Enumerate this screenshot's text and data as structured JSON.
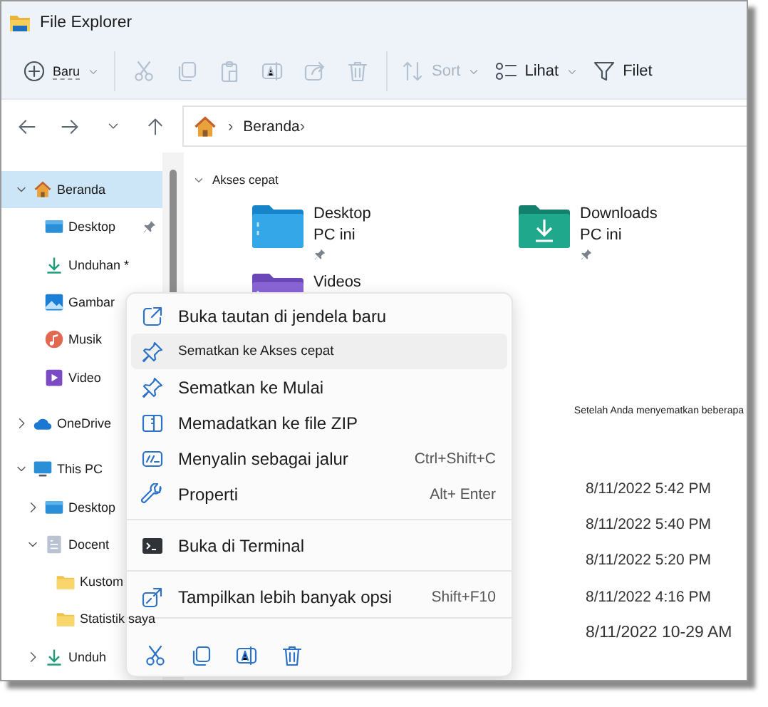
{
  "window": {
    "title": "File Explorer"
  },
  "toolbar": {
    "items": [
      {
        "kind": "new",
        "label": "Baru",
        "disabled": false
      },
      {
        "kind": "cut",
        "disabled": true
      },
      {
        "kind": "copy",
        "disabled": true
      },
      {
        "kind": "paste",
        "disabled": true
      },
      {
        "kind": "rename",
        "disabled": true
      },
      {
        "kind": "share",
        "disabled": true
      },
      {
        "kind": "delete",
        "disabled": true
      },
      {
        "kind": "sort",
        "label": "Sort",
        "disabled": true
      },
      {
        "kind": "view",
        "label": "Lihat",
        "disabled": false
      },
      {
        "kind": "filter",
        "label": "Filet",
        "disabled": false
      }
    ]
  },
  "address": {
    "path": [
      "›",
      "Beranda",
      "›"
    ]
  },
  "sidebar": {
    "items": [
      {
        "kind": "home",
        "label": "Beranda",
        "expanded": true,
        "selected": true,
        "children": [
          {
            "kind": "desktop",
            "label": "Desktop",
            "pinned": true,
            "selected": false
          },
          {
            "kind": "download",
            "label": "Unduhan *",
            "pinned": false,
            "selected": false
          },
          {
            "kind": "pictures",
            "label": "Gambar",
            "pinned": false,
            "selected": false
          },
          {
            "kind": "music",
            "label": "Musik",
            "pinned": false,
            "selected": false
          },
          {
            "kind": "video",
            "label": "Video",
            "pinned": false,
            "selected": false
          }
        ]
      },
      {
        "kind": "cloud",
        "label": "OneDrive",
        "expanded": false,
        "selected": false
      },
      {
        "kind": "pc",
        "label": "This PC",
        "expanded": true,
        "selected": false,
        "children": [
          {
            "kind": "desktop",
            "label": "Desktop",
            "expanded": false,
            "selected": false
          },
          {
            "kind": "document",
            "label": "Docent",
            "expanded": true,
            "selected": false,
            "children": [
              {
                "kind": "folder",
                "label": "Kustom",
                "selected": false
              },
              {
                "kind": "folder",
                "label": "Statistik saya",
                "selected": false
              }
            ]
          },
          {
            "kind": "download",
            "label": "Unduh",
            "expanded": false,
            "selected": false
          }
        ]
      }
    ]
  },
  "quick_access": {
    "title": "Akses cepat",
    "expanded": true,
    "tiles": [
      {
        "kind": "desktop",
        "name": "Desktop",
        "location": "PC ini",
        "pinned": true
      },
      {
        "kind": "downloads",
        "name": "Downloads",
        "location": "PC ini",
        "pinned": true
      },
      {
        "kind": "video",
        "name": "Videos"
      }
    ]
  },
  "notice": "Setelah Anda menyematkan beberapa",
  "files": {
    "rows": [
      {
        "modified": "8/11/2022 5:42 PM"
      },
      {
        "modified": "8/11/2022 5:40 PM"
      },
      {
        "modified": "8/11/2022 5:20 PM"
      },
      {
        "modified": "8/11/2022 4:16 PM"
      },
      {
        "modified": "8/11/2022 10-29 AM"
      }
    ]
  },
  "context_menu": {
    "groups": [
      [
        {
          "kind": "open-link",
          "label": "Buka tautan di jendela baru",
          "selected": false
        },
        {
          "kind": "pin",
          "label": "Sematkan ke Akses cepat",
          "selected": true
        },
        {
          "kind": "pin",
          "label": "Sematkan ke Mulai",
          "selected": false
        },
        {
          "kind": "zip",
          "label": "Memadatkan ke file ZIP",
          "selected": false
        },
        {
          "kind": "copy-path",
          "label": "Menyalin sebagai jalur",
          "shortcut": "Ctrl+Shift+C",
          "selected": false
        },
        {
          "kind": "properties",
          "label": "Properti",
          "shortcut": "Alt+ Enter",
          "selected": false
        }
      ],
      [
        {
          "kind": "terminal",
          "label": "Buka di Terminal",
          "selected": false
        }
      ],
      [
        {
          "kind": "more",
          "label": "Tampilkan lebih banyak opsi",
          "shortcut": "Shift+F10",
          "selected": false
        }
      ]
    ],
    "quick_actions": [
      {
        "kind": "cut"
      },
      {
        "kind": "copy"
      },
      {
        "kind": "rename"
      },
      {
        "kind": "delete"
      }
    ]
  }
}
